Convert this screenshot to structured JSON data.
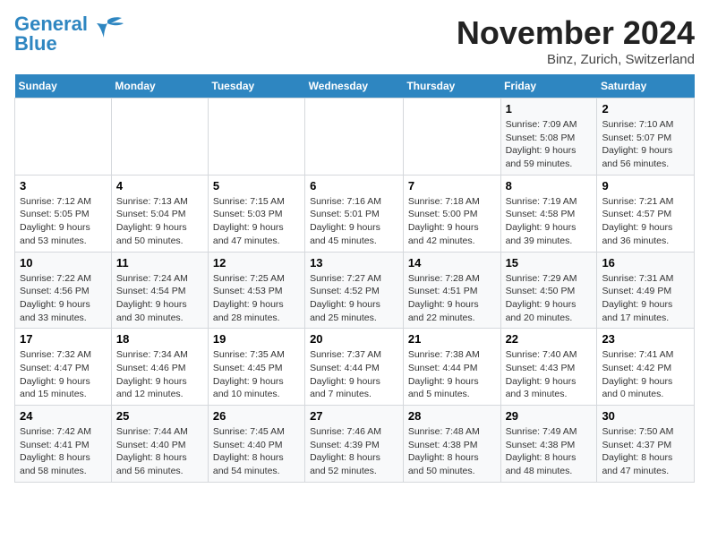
{
  "header": {
    "logo_general": "General",
    "logo_blue": "Blue",
    "month_title": "November 2024",
    "location": "Binz, Zurich, Switzerland"
  },
  "days_of_week": [
    "Sunday",
    "Monday",
    "Tuesday",
    "Wednesday",
    "Thursday",
    "Friday",
    "Saturday"
  ],
  "weeks": [
    [
      {
        "day": "",
        "info": ""
      },
      {
        "day": "",
        "info": ""
      },
      {
        "day": "",
        "info": ""
      },
      {
        "day": "",
        "info": ""
      },
      {
        "day": "",
        "info": ""
      },
      {
        "day": "1",
        "info": "Sunrise: 7:09 AM\nSunset: 5:08 PM\nDaylight: 9 hours and 59 minutes."
      },
      {
        "day": "2",
        "info": "Sunrise: 7:10 AM\nSunset: 5:07 PM\nDaylight: 9 hours and 56 minutes."
      }
    ],
    [
      {
        "day": "3",
        "info": "Sunrise: 7:12 AM\nSunset: 5:05 PM\nDaylight: 9 hours and 53 minutes."
      },
      {
        "day": "4",
        "info": "Sunrise: 7:13 AM\nSunset: 5:04 PM\nDaylight: 9 hours and 50 minutes."
      },
      {
        "day": "5",
        "info": "Sunrise: 7:15 AM\nSunset: 5:03 PM\nDaylight: 9 hours and 47 minutes."
      },
      {
        "day": "6",
        "info": "Sunrise: 7:16 AM\nSunset: 5:01 PM\nDaylight: 9 hours and 45 minutes."
      },
      {
        "day": "7",
        "info": "Sunrise: 7:18 AM\nSunset: 5:00 PM\nDaylight: 9 hours and 42 minutes."
      },
      {
        "day": "8",
        "info": "Sunrise: 7:19 AM\nSunset: 4:58 PM\nDaylight: 9 hours and 39 minutes."
      },
      {
        "day": "9",
        "info": "Sunrise: 7:21 AM\nSunset: 4:57 PM\nDaylight: 9 hours and 36 minutes."
      }
    ],
    [
      {
        "day": "10",
        "info": "Sunrise: 7:22 AM\nSunset: 4:56 PM\nDaylight: 9 hours and 33 minutes."
      },
      {
        "day": "11",
        "info": "Sunrise: 7:24 AM\nSunset: 4:54 PM\nDaylight: 9 hours and 30 minutes."
      },
      {
        "day": "12",
        "info": "Sunrise: 7:25 AM\nSunset: 4:53 PM\nDaylight: 9 hours and 28 minutes."
      },
      {
        "day": "13",
        "info": "Sunrise: 7:27 AM\nSunset: 4:52 PM\nDaylight: 9 hours and 25 minutes."
      },
      {
        "day": "14",
        "info": "Sunrise: 7:28 AM\nSunset: 4:51 PM\nDaylight: 9 hours and 22 minutes."
      },
      {
        "day": "15",
        "info": "Sunrise: 7:29 AM\nSunset: 4:50 PM\nDaylight: 9 hours and 20 minutes."
      },
      {
        "day": "16",
        "info": "Sunrise: 7:31 AM\nSunset: 4:49 PM\nDaylight: 9 hours and 17 minutes."
      }
    ],
    [
      {
        "day": "17",
        "info": "Sunrise: 7:32 AM\nSunset: 4:47 PM\nDaylight: 9 hours and 15 minutes."
      },
      {
        "day": "18",
        "info": "Sunrise: 7:34 AM\nSunset: 4:46 PM\nDaylight: 9 hours and 12 minutes."
      },
      {
        "day": "19",
        "info": "Sunrise: 7:35 AM\nSunset: 4:45 PM\nDaylight: 9 hours and 10 minutes."
      },
      {
        "day": "20",
        "info": "Sunrise: 7:37 AM\nSunset: 4:44 PM\nDaylight: 9 hours and 7 minutes."
      },
      {
        "day": "21",
        "info": "Sunrise: 7:38 AM\nSunset: 4:44 PM\nDaylight: 9 hours and 5 minutes."
      },
      {
        "day": "22",
        "info": "Sunrise: 7:40 AM\nSunset: 4:43 PM\nDaylight: 9 hours and 3 minutes."
      },
      {
        "day": "23",
        "info": "Sunrise: 7:41 AM\nSunset: 4:42 PM\nDaylight: 9 hours and 0 minutes."
      }
    ],
    [
      {
        "day": "24",
        "info": "Sunrise: 7:42 AM\nSunset: 4:41 PM\nDaylight: 8 hours and 58 minutes."
      },
      {
        "day": "25",
        "info": "Sunrise: 7:44 AM\nSunset: 4:40 PM\nDaylight: 8 hours and 56 minutes."
      },
      {
        "day": "26",
        "info": "Sunrise: 7:45 AM\nSunset: 4:40 PM\nDaylight: 8 hours and 54 minutes."
      },
      {
        "day": "27",
        "info": "Sunrise: 7:46 AM\nSunset: 4:39 PM\nDaylight: 8 hours and 52 minutes."
      },
      {
        "day": "28",
        "info": "Sunrise: 7:48 AM\nSunset: 4:38 PM\nDaylight: 8 hours and 50 minutes."
      },
      {
        "day": "29",
        "info": "Sunrise: 7:49 AM\nSunset: 4:38 PM\nDaylight: 8 hours and 48 minutes."
      },
      {
        "day": "30",
        "info": "Sunrise: 7:50 AM\nSunset: 4:37 PM\nDaylight: 8 hours and 47 minutes."
      }
    ]
  ]
}
